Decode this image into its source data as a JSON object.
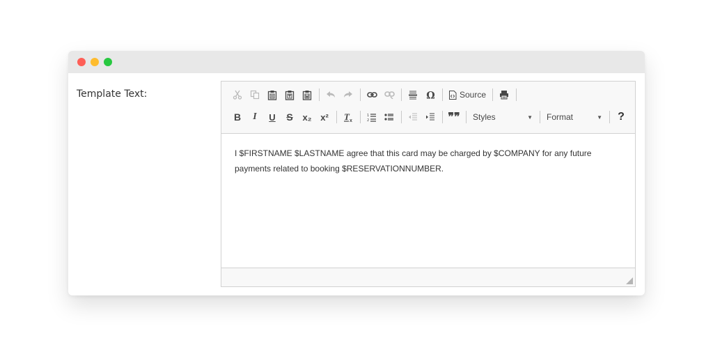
{
  "window": {
    "controls": [
      "close",
      "minimize",
      "maximize"
    ]
  },
  "form": {
    "label": "Template Text:"
  },
  "toolbar": {
    "row1": [
      {
        "name": "cut-icon",
        "disabled": true
      },
      {
        "name": "copy-icon",
        "disabled": true
      },
      {
        "name": "paste-icon"
      },
      {
        "name": "paste-text-icon"
      },
      {
        "name": "paste-from-word-icon"
      },
      {
        "name": "undo-icon",
        "disabled": true
      },
      {
        "name": "redo-icon",
        "disabled": true
      },
      {
        "name": "link-icon"
      },
      {
        "name": "unlink-icon",
        "disabled": true
      },
      {
        "name": "horizontal-line-icon"
      },
      {
        "name": "special-character-icon"
      },
      {
        "name": "source-icon"
      },
      {
        "name": "print-icon"
      }
    ],
    "source_label": "Source",
    "row2_glyphs": {
      "bold": "B",
      "italic": "I",
      "underline": "U",
      "strike": "S",
      "subscript": "x₂",
      "superscript": "x²",
      "remove_format": "Tx",
      "blockquote": "❞❞",
      "help": "?"
    },
    "styles_label": "Styles",
    "format_label": "Format"
  },
  "editor": {
    "content": "I $FIRSTNAME $LASTNAME agree that this card may be charged by $COMPANY for any future payments related to booking $RESERVATIONNUMBER."
  }
}
